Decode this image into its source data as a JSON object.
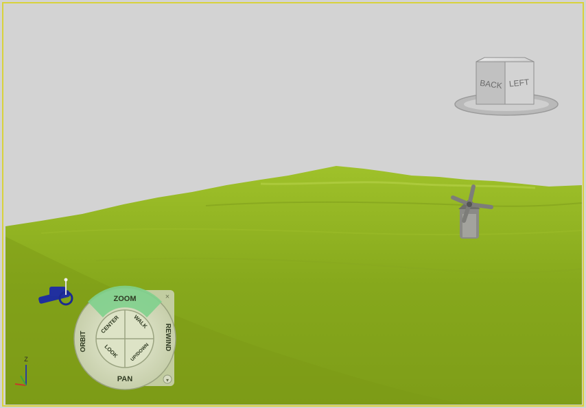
{
  "viewcube": {
    "face_back": "BACK",
    "face_left": "LEFT"
  },
  "steering_wheel": {
    "zoom": "ZOOM",
    "orbit": "ORBIT",
    "rewind": "REWIND",
    "pan": "PAN",
    "center": "CENTER",
    "walk": "WALK",
    "look": "LOOK",
    "updown": "UP/DOWN",
    "close_glyph": "×",
    "menu_glyph": "▾"
  },
  "axis_tripod": {
    "z_label": "Z"
  },
  "colors": {
    "sky": "#d3d3d3",
    "terrain": "#8fb121",
    "frame": "#d8d23a",
    "wheel_highlight": "#7fd08d"
  }
}
